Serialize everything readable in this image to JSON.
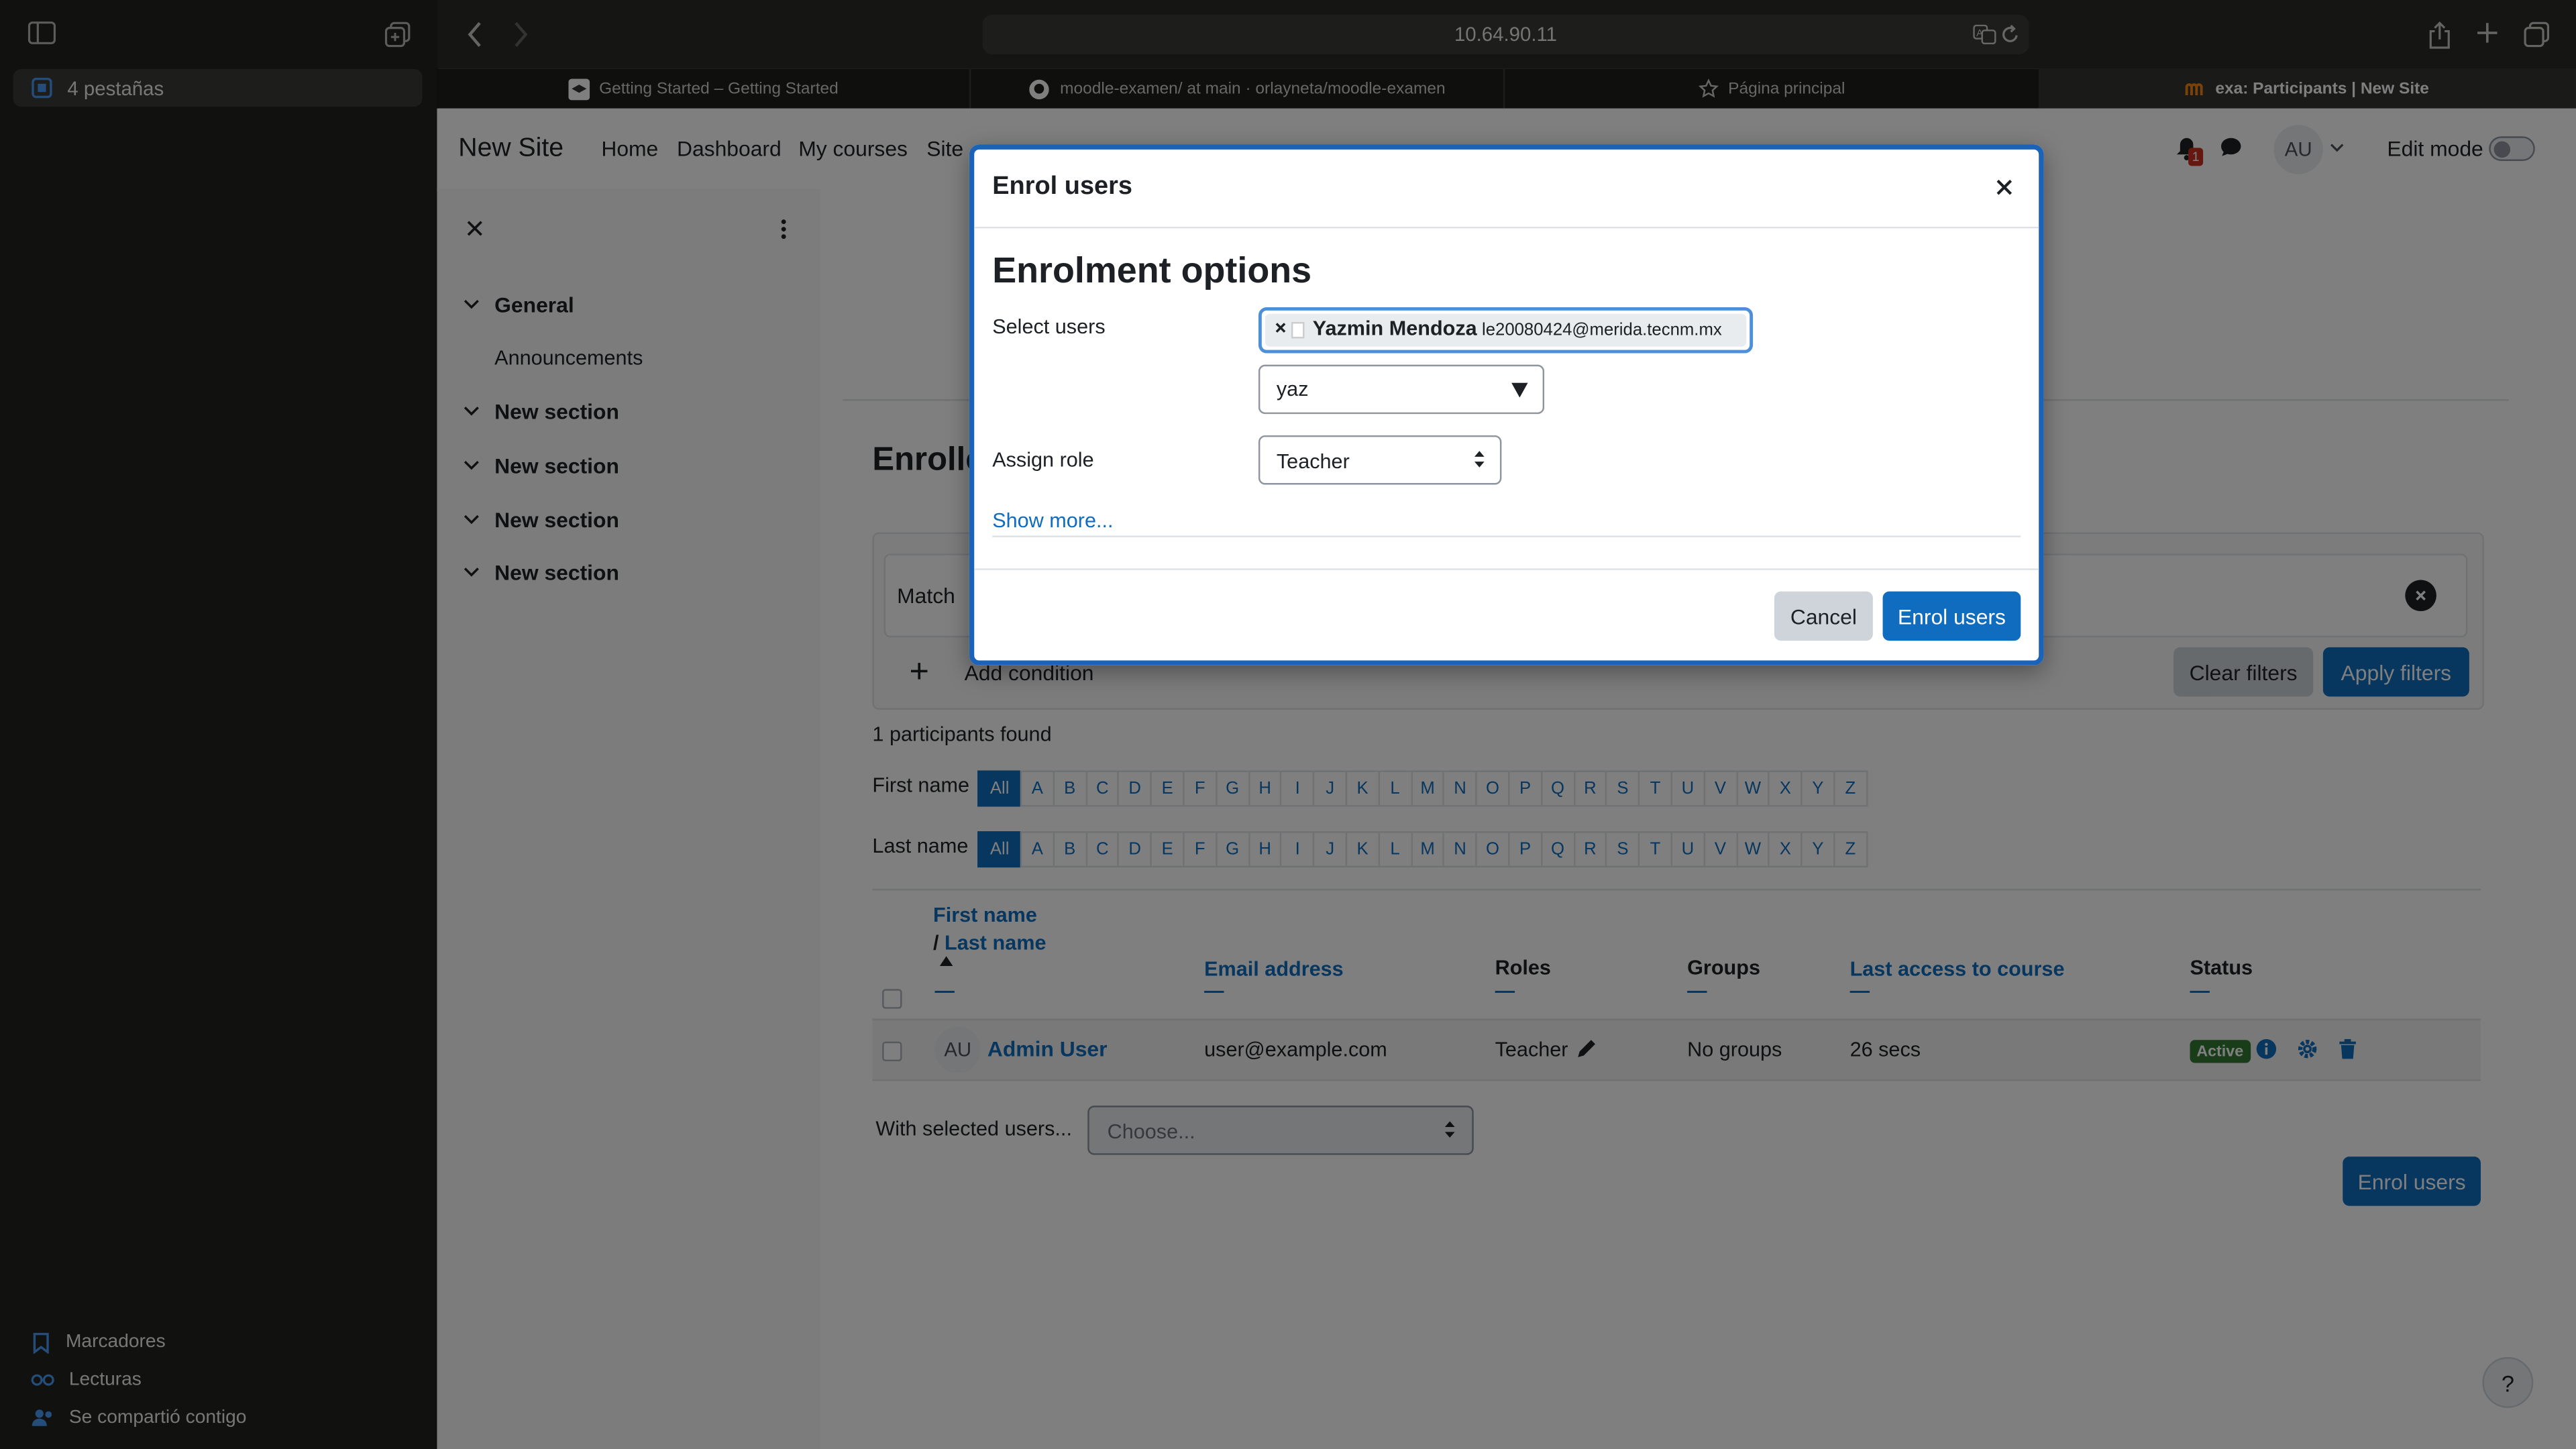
{
  "safari": {
    "address": "10.64.90.11",
    "tab_group_label": "4 pestañas",
    "sidebar_links": [
      {
        "label": "Marcadores"
      },
      {
        "label": "Lecturas"
      },
      {
        "label": "Se compartió contigo"
      }
    ],
    "tabs": [
      {
        "label": "Getting Started – Getting Started"
      },
      {
        "label": "moodle-examen/ at main · orlayneta/moodle-examen"
      },
      {
        "label": "Página principal"
      },
      {
        "label": "exa: Participants | New Site"
      }
    ]
  },
  "navbar": {
    "site_name": "New Site",
    "links": [
      "Home",
      "Dashboard",
      "My courses",
      "Site"
    ],
    "notification_count": "1",
    "avatar_initials": "AU",
    "edit_mode_label": "Edit mode"
  },
  "drawer": {
    "sections": [
      {
        "label": "General",
        "items": [
          "Announcements"
        ]
      },
      {
        "label": "New section"
      },
      {
        "label": "New section"
      },
      {
        "label": "New section"
      },
      {
        "label": "New section"
      }
    ]
  },
  "main": {
    "heading_partial": "Enrolle",
    "filter": {
      "match_label": "Match",
      "add_condition": "Add condition",
      "clear_filters": "Clear filters",
      "apply_filters": "Apply filters"
    },
    "participants_found": "1 participants found",
    "first_name_label": "First name",
    "last_name_label": "Last name",
    "letters": [
      "All",
      "A",
      "B",
      "C",
      "D",
      "E",
      "F",
      "G",
      "H",
      "I",
      "J",
      "K",
      "L",
      "M",
      "N",
      "O",
      "P",
      "Q",
      "R",
      "S",
      "T",
      "U",
      "V",
      "W",
      "X",
      "Y",
      "Z"
    ],
    "table": {
      "headers": {
        "first_name": "First name",
        "last_name": "Last name",
        "email": "Email address",
        "roles": "Roles",
        "groups": "Groups",
        "last_access": "Last access to course",
        "status": "Status"
      },
      "rows": [
        {
          "initials": "AU",
          "name": "Admin User",
          "email": "user@example.com",
          "role": "Teacher",
          "groups": "No groups",
          "last_access": "26 secs",
          "status": "Active"
        }
      ]
    },
    "with_selected_label": "With selected users...",
    "with_selected_placeholder": "Choose...",
    "enrol_users_button": "Enrol users",
    "help_button": "?"
  },
  "modal": {
    "title": "Enrol users",
    "heading": "Enrolment options",
    "select_users_label": "Select users",
    "selected_user_name": "Yazmin Mendoza",
    "selected_user_email": "le20080424@merida.tecnm.mx",
    "search_value": "yaz",
    "assign_role_label": "Assign role",
    "role_value": "Teacher",
    "show_more": "Show more...",
    "cancel": "Cancel",
    "enrol": "Enrol users"
  },
  "colors": {
    "primary": "#0f6cbf",
    "active_badge": "#357a32",
    "modal_focus_border": "#1b63b8"
  }
}
